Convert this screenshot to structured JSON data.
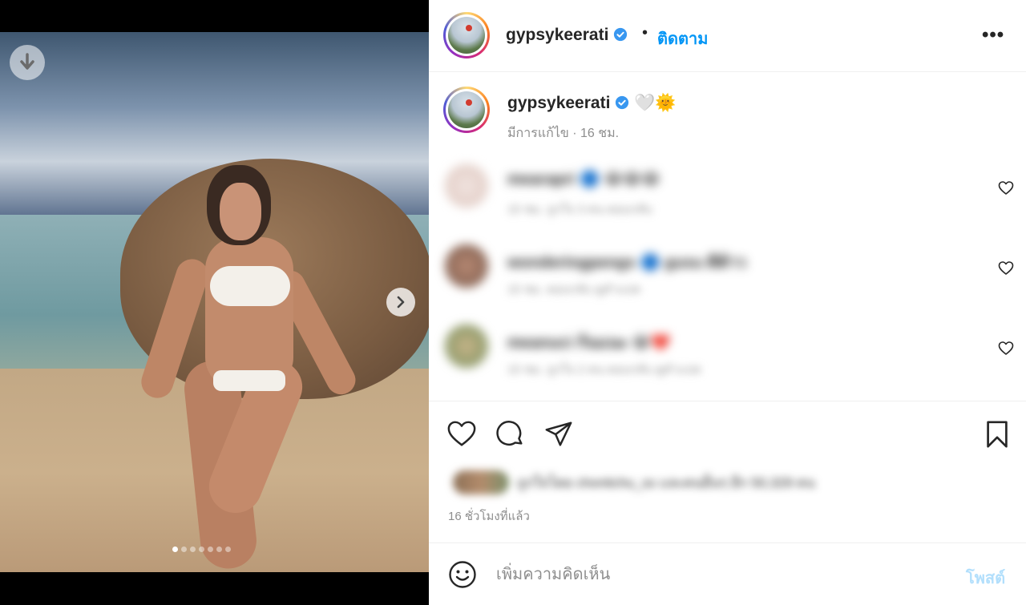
{
  "post": {
    "username": "gypsykeerati",
    "follow_label": "ติดตาม",
    "bullet": "•",
    "more_label": "•••",
    "caption": "🤍🌞",
    "caption_meta": "มีการแก้ไข · 16 ชม.",
    "time_ago": "16 ชั่วโมงที่แล้ว",
    "likes_text": "ถูกใจโดย chontichu_ss และคนอื่นๆ อีก 50,329 คน",
    "carousel": {
      "slide_count": 7,
      "active_index": 0
    }
  },
  "comments": [
    {
      "text": "mearapri 🔵 😂😂😂",
      "sub": "15 ชม.   ถูกใจ 3 คน   ตอบกลับ"
    },
    {
      "text": "wonderingpengs 🔵 gusu ดีต้าว",
      "sub": "15 ชม.   ตอบกลับ   ดูคำแปล"
    },
    {
      "text": "meanuci ก้นแนะ 😂❤️",
      "sub": "15 ชม.   ถูกใจ 2 คน   ตอบกลับ   ดูคำแปล"
    }
  ],
  "comment_box": {
    "placeholder": "เพิ่มความคิดเห็น",
    "post_label": "โพสต์"
  },
  "colors": {
    "accent": "#0095f6",
    "verified": "#3897f0",
    "post_disabled": "#b2dffc"
  },
  "icons": [
    "download-icon",
    "chevron-right-icon",
    "verified-icon",
    "more-icon",
    "heart-icon",
    "comment-icon",
    "share-icon",
    "bookmark-icon",
    "emoji-icon"
  ]
}
